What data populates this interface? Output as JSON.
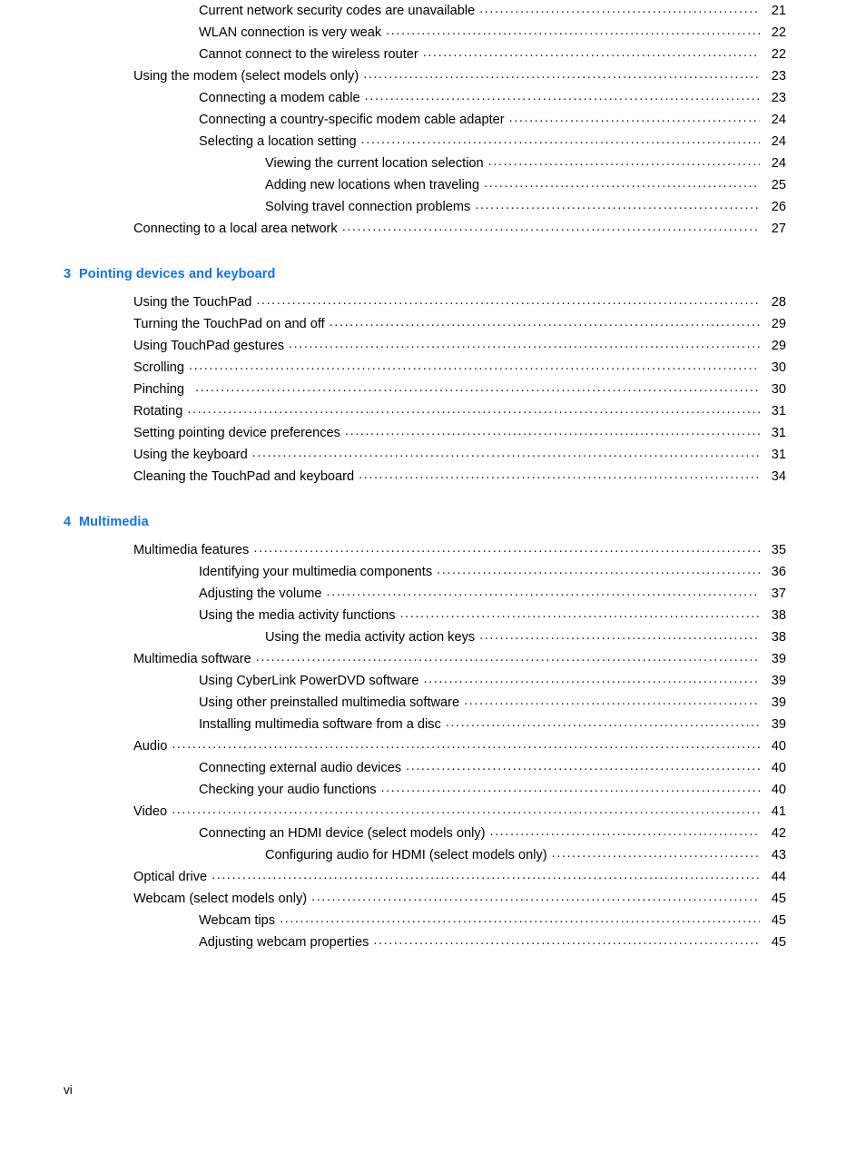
{
  "page": {
    "footer_page_number": "vi",
    "accent_color": "#1273EB",
    "text_color": "#000000"
  },
  "toc": {
    "blocks": [
      {
        "type": "entries",
        "entries": [
          {
            "level": 2,
            "title": "Current network security codes are unavailable",
            "page": "21"
          },
          {
            "level": 2,
            "title": "WLAN connection is very weak",
            "page": "22"
          },
          {
            "level": 2,
            "title": "Cannot connect to the wireless router",
            "page": "22"
          },
          {
            "level": 1,
            "title": "Using the modem (select models only)",
            "page": "23"
          },
          {
            "level": 2,
            "title": "Connecting a modem cable",
            "page": "23"
          },
          {
            "level": 2,
            "title": "Connecting a country-specific modem cable adapter",
            "page": "24"
          },
          {
            "level": 2,
            "title": "Selecting a location setting",
            "page": "24"
          },
          {
            "level": 3,
            "title": "Viewing the current location selection",
            "page": "24"
          },
          {
            "level": 3,
            "title": "Adding new locations when traveling",
            "page": "25"
          },
          {
            "level": 3,
            "title": "Solving travel connection problems",
            "page": "26"
          },
          {
            "level": 1,
            "title": "Connecting to a local area network",
            "page": "27"
          }
        ]
      },
      {
        "type": "chapter",
        "number": "3",
        "title": "Pointing devices and keyboard",
        "entries": [
          {
            "level": 1,
            "title": "Using the TouchPad",
            "page": "28"
          },
          {
            "level": 1,
            "title": "Turning the TouchPad on and off",
            "page": "29"
          },
          {
            "level": 1,
            "title": "Using TouchPad gestures",
            "page": "29"
          },
          {
            "level": 1,
            "title": "Scrolling",
            "page": "30"
          },
          {
            "level": 1,
            "title": "Pinching",
            "page": "30",
            "extra_space": true
          },
          {
            "level": 1,
            "title": "Rotating",
            "page": "31"
          },
          {
            "level": 1,
            "title": "Setting pointing device preferences",
            "page": "31"
          },
          {
            "level": 1,
            "title": "Using the keyboard",
            "page": "31"
          },
          {
            "level": 1,
            "title": "Cleaning the TouchPad and keyboard",
            "page": "34"
          }
        ]
      },
      {
        "type": "chapter",
        "number": "4",
        "title": "Multimedia",
        "entries": [
          {
            "level": 1,
            "title": "Multimedia features",
            "page": "35"
          },
          {
            "level": 2,
            "title": "Identifying your multimedia components",
            "page": "36"
          },
          {
            "level": 2,
            "title": "Adjusting the volume",
            "page": "37"
          },
          {
            "level": 2,
            "title": "Using the media activity functions",
            "page": "38"
          },
          {
            "level": 3,
            "title": "Using the media activity action keys",
            "page": "38"
          },
          {
            "level": 1,
            "title": "Multimedia software",
            "page": "39"
          },
          {
            "level": 2,
            "title": "Using CyberLink PowerDVD software",
            "page": "39"
          },
          {
            "level": 2,
            "title": "Using other preinstalled multimedia software",
            "page": "39"
          },
          {
            "level": 2,
            "title": "Installing multimedia software from a disc",
            "page": "39"
          },
          {
            "level": 1,
            "title": "Audio",
            "page": "40"
          },
          {
            "level": 2,
            "title": "Connecting external audio devices",
            "page": "40"
          },
          {
            "level": 2,
            "title": "Checking your audio functions",
            "page": "40"
          },
          {
            "level": 1,
            "title": "Video",
            "page": "41"
          },
          {
            "level": 2,
            "title": "Connecting an HDMI device (select models only)",
            "page": "42"
          },
          {
            "level": 3,
            "title": "Configuring audio for HDMI (select models only)",
            "page": "43"
          },
          {
            "level": 1,
            "title": "Optical drive",
            "page": "44"
          },
          {
            "level": 1,
            "title": "Webcam (select models only)",
            "page": "45"
          },
          {
            "level": 2,
            "title": "Webcam tips",
            "page": "45"
          },
          {
            "level": 2,
            "title": "Adjusting webcam properties",
            "page": "45"
          }
        ]
      }
    ]
  }
}
